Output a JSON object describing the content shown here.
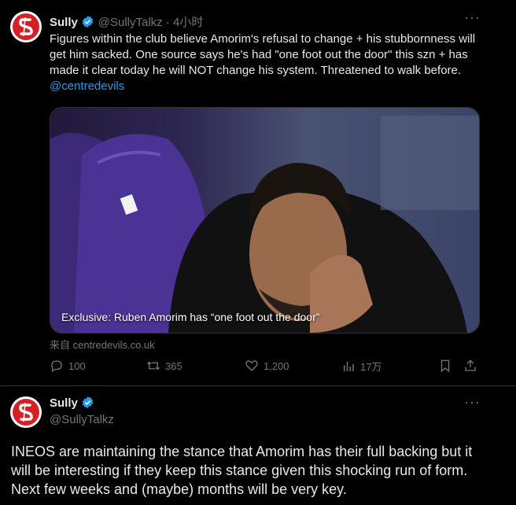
{
  "tweet1": {
    "name": "Sully",
    "handle": "@SullyTalkz",
    "time": " · 4小时",
    "text": "Figures within the club believe Amorim's refusal to change + his stubbornness will get him sacked. One source says he's had \"one foot out the door\" this szn +  has made it clear today he will NOT change his system. Threatened to walk before. ",
    "link": "@centredevils",
    "caption": "Exclusive: Ruben Amorim has “one foot out the door”",
    "source": "来自 centredevils.co.uk",
    "replies": "100",
    "reposts": "365",
    "likes": "1,200",
    "views": "17万"
  },
  "tweet2": {
    "name": "Sully",
    "handle": "@SullyTalkz",
    "text": "INEOS are maintaining the stance that Amorim has their full backing but it will be interesting if they keep this stance given this shocking run of form. Next few weeks and (maybe) months will be very key."
  },
  "colors": {
    "background": "#000000",
    "text": "#e7e9ea",
    "muted": "#71767b",
    "link": "#1d9bf0",
    "verified": "#1d9bf0",
    "avatar": "#d71f26"
  },
  "icons": [
    "avatar-logo",
    "verified-badge-icon",
    "more-icon",
    "reply-icon",
    "repost-icon",
    "like-icon",
    "views-icon",
    "bookmark-icon",
    "share-icon"
  ]
}
